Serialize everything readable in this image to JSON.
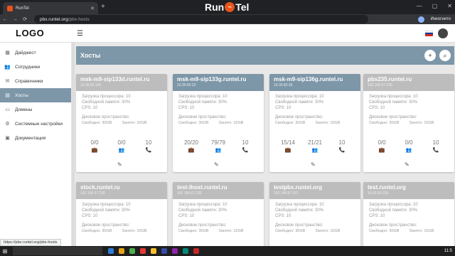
{
  "browser": {
    "tab_title": "RunTel",
    "tab_close": "✕",
    "new_tab": "+",
    "url_domain": "pbx.runtel.org",
    "url_path": "/pbx-hosts",
    "profile_name": "Инкогнито",
    "window_controls": [
      "—",
      "▢",
      "✕"
    ],
    "nav_icons": [
      "←",
      "→",
      "⟳"
    ]
  },
  "overlay_logo": {
    "part1": "Run",
    "o": "~",
    "part2": "Tel"
  },
  "app": {
    "logo": "LOGO",
    "menu_icon": "☰"
  },
  "sidebar": {
    "items": [
      {
        "label": "Дайджест",
        "icon": "▦"
      },
      {
        "label": "Сотрудники",
        "icon": "👥"
      },
      {
        "label": "Справочники",
        "icon": "✉"
      },
      {
        "label": "Хосты",
        "icon": "▤",
        "active": true
      },
      {
        "label": "Домены",
        "icon": "▭"
      },
      {
        "label": "Системные настройки",
        "icon": "⚙"
      },
      {
        "label": "Документация",
        "icon": "▣"
      }
    ]
  },
  "hosts": {
    "title": "Хосты",
    "add_icon": "+",
    "search_icon": "⌕",
    "cards": [
      {
        "name": "msk-m9-sip133d.runtel.ru",
        "ip": "10.30.50.130",
        "header": "gray",
        "cpu": "Загрузка процессора: 10",
        "mem": "Свободной памяти: 30%",
        "cps": "CPS: 10",
        "disk_label": "Дисковое пространство:",
        "free": "Свободно: 30GB",
        "used": "Занято: 10GB",
        "stats": [
          "0/0",
          "0/0",
          "10"
        ]
      },
      {
        "name": "msk-m9-sip133g.runtel.ru",
        "ip": "10.30.50.23",
        "header": "blue",
        "cpu": "Загрузка процессора: 10",
        "mem": "Свободной памяти: 30%",
        "cps": "CPS: 10",
        "disk_label": "Дисковое пространство:",
        "free": "Свободно: 30GB",
        "used": "Занято: 10GB",
        "stats": [
          "20/20",
          "79/79",
          "10"
        ]
      },
      {
        "name": "msk-m9-sip136g.runtel.ru",
        "ip": "10.30.50.36",
        "header": "blue",
        "cpu": "Загрузка процессора: 10",
        "mem": "Свободной памяти: 30%",
        "cps": "CPS: 10",
        "disk_label": "Дисковое пространство:",
        "free": "Свободно: 30GB",
        "used": "Занято: 10GB",
        "stats": [
          "15/14",
          "21/21",
          "10"
        ]
      },
      {
        "name": "pbx235.runtel.ru",
        "ip": "192.168.67.230",
        "header": "gray",
        "cpu": "Загрузка процессора: 10",
        "mem": "Свободной памяти: 30%",
        "cps": "CPS: 10",
        "disk_label": "Дисковое пространство:",
        "free": "Свободно: 30GB",
        "used": "Занято: 10GB",
        "stats": [
          "0/0",
          "0/0",
          "10"
        ]
      },
      {
        "name": "stock.runtel.ru",
        "ip": "192.168.67.230",
        "header": "gray",
        "cpu": "Загрузка процессора: 10",
        "mem": "Свободной памяти: 30%",
        "cps": "CPS: 10",
        "disk_label": "Дисковое пространство:",
        "free": "Свободно: 30GB",
        "used": "Занято: 10GB"
      },
      {
        "name": "test-lhost.runtel.ru",
        "ip": "192.168.67.230",
        "header": "gray",
        "cpu": "Загрузка процессора: 10",
        "mem": "Свободной памяти: 30%",
        "cps": "CPS: 10",
        "disk_label": "Дисковое пространство:",
        "free": "Свободно: 30GB",
        "used": "Занято: 10GB"
      },
      {
        "name": "testpbx.runtel.org",
        "ip": "192.168.67.167",
        "header": "gray",
        "cpu": "Загрузка процессора: 10",
        "mem": "Свободной памяти: 30%",
        "cps": "CPS: 10",
        "disk_label": "Дисковое пространство:",
        "free": "Свободно: 30GB",
        "used": "Занято: 10GB"
      },
      {
        "name": "test.runtel.org",
        "ip": "10.30.50.229",
        "header": "gray",
        "cpu": "Загрузка процессора: 10",
        "mem": "Свободной памяти: 30%",
        "cps": "CPS: 10",
        "disk_label": "Дисковое пространство:",
        "free": "Свободно: 30GB",
        "used": "Занято: 10GB"
      }
    ],
    "stat_icons": [
      "💼",
      "👥",
      "📞"
    ],
    "edit_icon": "✎"
  },
  "status_url": "https://pbx.runtel.org/pbx-hosts",
  "taskbar": {
    "start": "⊞",
    "search": "",
    "time": "11:5"
  },
  "colors": {
    "accent": "#7d96a8",
    "card_gray": "#bdbdbd"
  }
}
